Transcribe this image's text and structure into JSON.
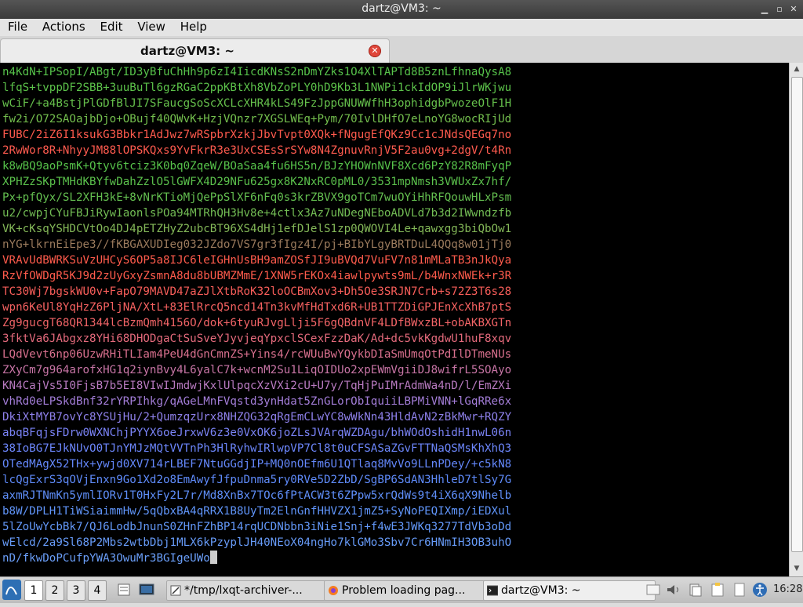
{
  "window": {
    "title": "dartz@VM3: ~"
  },
  "menu": [
    "File",
    "Actions",
    "Edit",
    "View",
    "Help"
  ],
  "tab": {
    "label": "dartz@VM3: ~"
  },
  "terminal": {
    "lines": [
      "n4KdN+IPSopI/ABgt/ID3yBfuChHh9p6zI4IicdKNsS2nDmYZks1O4XlTAPTd8B5znLfhnaQysA8",
      "lfqS+tvppDF2SBB+3uuBuTl6gzRGaC2ppKBtXh8VbZoPLY0hD9Kb3L1NWPi1ckIdOP9iJlrWKjwu",
      "wCiF/+a4BstjPlGDfBlJI7SFaucgSoScXCLcXHR4kLS49FzJppGNUWWfhH3ophidgbPwozeOlF1H",
      "fw2i/O72SAOajbDjo+OBujf40QWvK+HzjVQnzr7XGSLWEq+Pym/70IvlDHfO7eLnoYG8wocRIjUd",
      "FUBC/2iZ6I1ksukG3Bbkr1AdJwz7wRSpbrXzkjJbvTvpt0XQk+fNgugEfQKz9Cc1cJNdsQEGq7no",
      "2RwWor8R+NhyyJM88lOPSKQxs9YvFkrR3e3UxCSEsSrSYw8N4ZgnuvRnjV5F2au0vg+2dgV/t4Rn",
      "k8wBQ9aoPsmK+Qtyv6tciz3K0bq0ZqeW/BOaSaa4fu6HS5n/BJzYHOWnNVF8Xcd6PzY82R8mFyqP",
      "XPHZzSKpTMHdKBYfwDahZzlO5lGWFX4D29NFu625gx8K2NxRC0pML0/3531mpNmsh3VWUxZx7hf/",
      "Px+pfQyx/SL2XFH3kE+8vNrKTioMjQePpSlXF6nFq0s3krZBVX9goTCm7wuOYiHhRFQouwHLxPsm",
      "u2/cwpjCYuFBJiRywIaonlsPOa94MTRhQH3Hv8e+4ctlx3Az7uNDegNEboADVLd7b3d2IWwndzfb",
      "VK+cKsqYSHDCVtOo4DJ4pETZHyZ2ubcBT96XS4dHj1efDJelS1zp0QWOVI4Le+qawxgg3biQbOw1",
      "nYG+lkrnEiEpe3//fKBGAXUDIeg032JZdo7VS7gr3fIgz4I/pj+BIbYLgyBRTDuL4QQq8w01jTj0",
      "VRAvUdBWRKSuVzUHCyS6OP5a8IJC6leIGHnUsBH9amZOSfJI9uBVQd7VuFV7n81mMLaTB3nJkQya",
      "RzVfOWDgR5KJ9d2zUyGxyZsmnA8du8bUBMZMmE/1XNW5rEKOx4iawlpywts9mL/b4WnxNWEk+r3R",
      "TC30Wj7bgskWU0v+FapO79MAVD47aZJlXtbRoK32loOCBmXov3+Dh5Oe3SRJN7Crb+s72Z3T6s28",
      "wpn6KeUl8YqHzZ6PljNA/XtL+83ElRrcQ5ncd14Tn3kvMfHdTxd6R+UB1TTZDiGPJEnXcXhB7ptS",
      "Zg9gucgT68QR1344lcBzmQmh4156O/dok+6tyuRJvgLlji5F6gQBdnVF4LDfBWxzBL+obAKBXGTn",
      "3fktVa6JAbgxz8YHi68DHODgaCtSuSveYJyvjeqYpxclSCexFzzDaK/Ad+dc5vkKgdwU1huF8xqv",
      "LQdVevt6np06UzwRHiTLIam4PeU4dGnCmnZS+Yins4/rcWUuBwYQykbDIaSmUmqOtPdIlDTmeNUs",
      "ZXyCm7g964arofxHG1q2iynBvy4L6yalC7k+wcnM2Su1LiqOIDUo2xpEWmVgiiDJ8wifrL5SOAyo",
      "KN4CajVs5I0FjsB7b5EI8VIwIJmdwjKxlUlpqcXzVXi2cU+U7y/TqHjPuIMrAdmWa4nD/l/EmZXi",
      "vhRd0eLPSkdBnf32rYRPIhkg/qAGeLMnFVqstd3ynHdat5ZnGLorObIquiiLBPMiVNN+lGqRRe6x",
      "DkiXtMYB7ovYc8YSUjHu/2+QumzqzUrx8NHZQG32qRgEmCLwYC8wWkNn43HldAvN2zBkMwr+RQZY",
      "abqBFqjsFDrw0WXNChjPYYX6oeJrxwV6z3e0VxOK6joZLsJVArqWZDAgu/bhWOdOshidH1nwL06n",
      "38IoBG7EJkNUvO0TJnYMJzMQtVVTnPh3HlRyhwIRlwpVP7Cl8t0uCFSASaZGvFTTNaQSMsKhXhQ3",
      "OTedMAgX52THx+ywjd0XV714rLBEF7NtuGGdjIP+MQ0nOEfm6U1QTlaq8MvVo9LLnPDey/+c5kN8",
      "lcQgExrS3qOVjEnxn9Go1Xd2o8EmAwyfJfpuDnma5ry0RVe5D2ZbD/SgBP6SdAN3HhleD7tlSy7G",
      "axmRJTNmKn5ymlIORv1T0HxFy2L7r/Md8XnBx7TOc6fPtACW3t6ZPpw5xrQdWs9t4iX6qX9Nhelb",
      "b8W/DPLH1TiWSiaimmHw/5qQbxBA4qRRX1B8UyTm2ElnGnfHHVZX1jmZ5+SyNoPEQIXmp/iEDXul",
      "5lZoUwYcbBk7/QJ6LodbJnunS0ZHnFZhBP14rqUCDNbbn3iNie1Snj+f4wE3JWKq3277TdVb3oDd",
      "wElcd/2a9Sl68P2Mbs2wtbDbj1MLX6kPzyplJH40NEoX04ngHo7klGMo3Sbv7Cr6HNmIH3OB3uhO",
      "nD/fkwDoPCufpYWA3OwuMr3BGIgeUWo"
    ],
    "colors": [
      "#56c24a",
      "#5cc24a",
      "#66c14c",
      "#74bf4e",
      "#ff5a4d",
      "#ff5b4f",
      "#56c24a",
      "#5bc14c",
      "#64bf50",
      "#72bc54",
      "#84b858",
      "#9a7a5c",
      "#ff5b4c",
      "#ff5b4c",
      "#f95e5a",
      "#f56160",
      "#f26467",
      "#e46a7c",
      "#d9708e",
      "#c875a6",
      "#b87ac0",
      "#a37dd8",
      "#8e80ea",
      "#7a83f6",
      "#6c86fb",
      "#6488fc",
      "#5f8bfb",
      "#5f8ffa",
      "#6095fa",
      "#6398f9",
      "#679bf8",
      "#6a9ef8"
    ]
  },
  "taskbar": {
    "desktops": [
      "1",
      "2",
      "3",
      "4"
    ],
    "tasks": [
      "*/tmp/lxqt-archiver-...",
      "Problem loading pag...",
      "dartz@VM3: ~"
    ],
    "clock": "16:28"
  }
}
